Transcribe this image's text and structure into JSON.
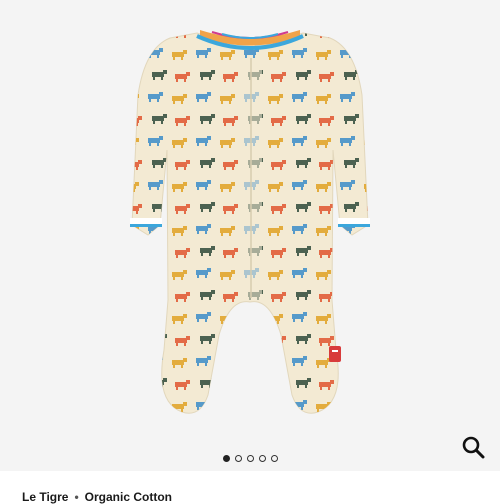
{
  "gallery": {
    "image_alt": "Le Tigre Organic Cotton Footie",
    "slide_count": 5,
    "active_slide": 1
  },
  "product": {
    "tags": [
      "Le Tigre",
      "Organic Cotton"
    ]
  },
  "icons": {
    "zoom": "search-icon"
  },
  "colors": {
    "background": "#f4f4f4",
    "fabric": "#f3ead3",
    "trim_blue": "#3ca7dc",
    "label_red": "#d83b3b"
  }
}
